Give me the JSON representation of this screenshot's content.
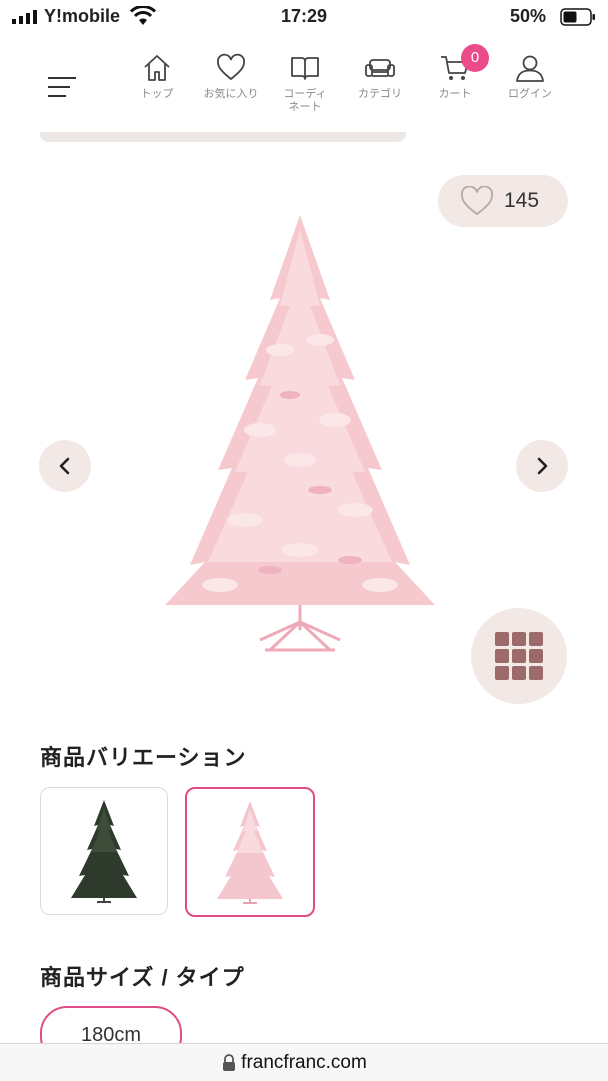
{
  "status_bar": {
    "carrier": "Y!mobile",
    "time": "17:29",
    "battery_percent": "50%"
  },
  "nav": {
    "items": [
      {
        "label": "トップ",
        "icon": "home-icon"
      },
      {
        "label": "お気に入り",
        "icon": "heart-icon"
      },
      {
        "label": "コーディ\nネート",
        "icon": "book-icon"
      },
      {
        "label": "カテゴリ",
        "icon": "sofa-icon"
      },
      {
        "label": "カート",
        "icon": "cart-icon"
      },
      {
        "label": "ログイン",
        "icon": "user-icon"
      }
    ],
    "cart_count": "0"
  },
  "product": {
    "favorite_count": "145",
    "image": "pink-christmas-tree"
  },
  "variations": {
    "title": "商品バリエーション",
    "items": [
      {
        "name": "green-tree",
        "selected": false
      },
      {
        "name": "pink-tree",
        "selected": true
      }
    ]
  },
  "size": {
    "title": "商品サイズ / タイプ",
    "options": [
      "180cm"
    ],
    "selected": "180cm"
  },
  "browser": {
    "url": "francfranc.com"
  },
  "colors": {
    "accent": "#ec4b8b",
    "button_bg": "#f2e9e6",
    "tree_pink": "#f6c9cf"
  }
}
